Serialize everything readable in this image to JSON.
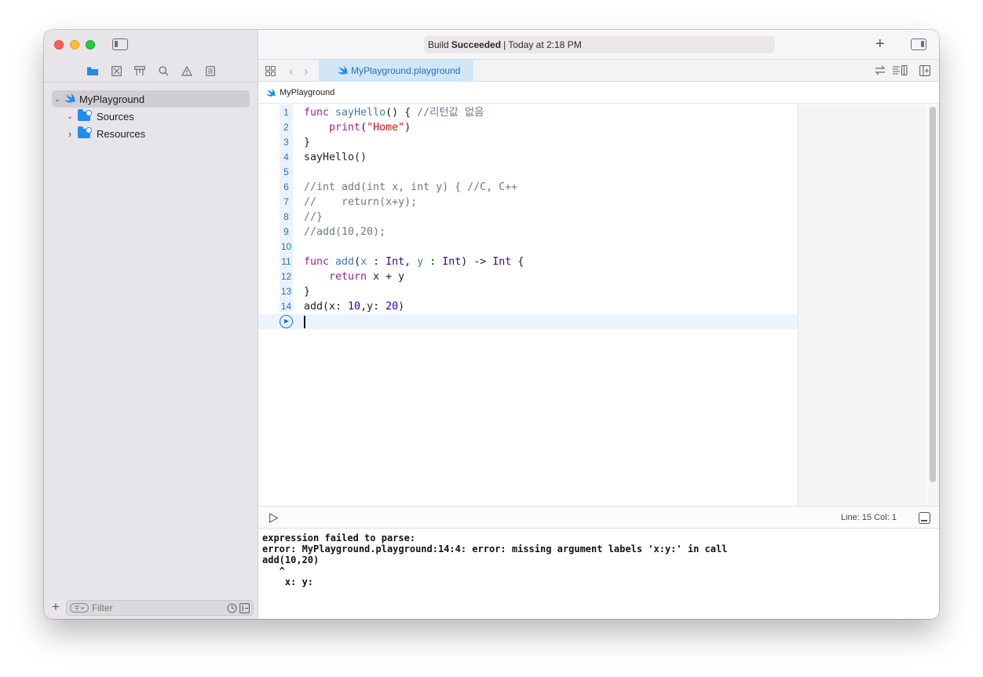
{
  "window": {
    "status": {
      "prefix": "Build",
      "result": "Succeeded",
      "time": "| Today at 2:18 PM"
    }
  },
  "navigator": {
    "icons": [
      "folder-icon",
      "source-control-icon",
      "symbol-icon",
      "search-icon",
      "issue-warning-icon",
      "report-icon"
    ],
    "tree": [
      {
        "label": "MyPlayground",
        "expanded": true,
        "selected": true
      },
      {
        "label": "Sources",
        "expanded": true
      },
      {
        "label": "Resources",
        "expanded": false
      }
    ],
    "filter": {
      "placeholder": "Filter"
    }
  },
  "tabs": {
    "active": "MyPlayground.playground"
  },
  "jumpbar": {
    "path": "MyPlayground"
  },
  "editor": {
    "line_numbers": [
      "1",
      "2",
      "3",
      "4",
      "5",
      "6",
      "7",
      "8",
      "9",
      "10",
      "11",
      "12",
      "13",
      "14"
    ],
    "current_line": 15
  },
  "statusbar": {
    "line_col": "Line: 15  Col: 1"
  },
  "console": {
    "lines": [
      "expression failed to parse:",
      "error: MyPlayground.playground:14:4: error: missing argument labels 'x:y:' in call",
      "add(10,20)",
      "   ^",
      "    x: y:"
    ]
  },
  "colors": {
    "accent": "#1a73d9",
    "keyword": "#9b2393",
    "string": "#c41a16",
    "comment": "#6c7986",
    "number": "#1c00cf"
  }
}
